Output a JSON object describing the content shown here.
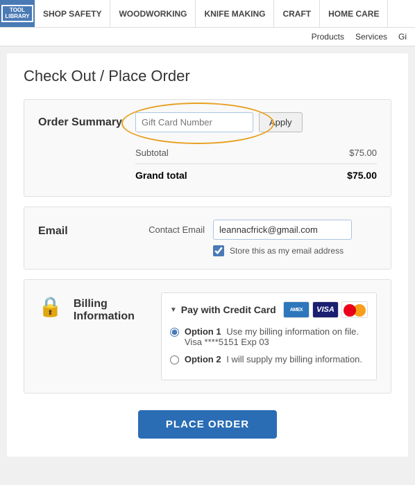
{
  "nav": {
    "logo_line1": "TOOL",
    "logo_line2": "LIBRARY",
    "items": [
      {
        "id": "shop-safety",
        "label": "SHOP SAFETY"
      },
      {
        "id": "woodworking",
        "label": "WOODWORKING"
      },
      {
        "id": "knife-making",
        "label": "KNIFE MAKING"
      },
      {
        "id": "craft",
        "label": "CRAFT"
      },
      {
        "id": "home-care",
        "label": "HOME CARE"
      }
    ]
  },
  "secondary_nav": {
    "items": [
      {
        "id": "products",
        "label": "Products"
      },
      {
        "id": "services",
        "label": "Services"
      },
      {
        "id": "gi",
        "label": "Gi"
      }
    ]
  },
  "page": {
    "title": "Check Out / Place Order"
  },
  "order_summary": {
    "section_label": "Order Summary",
    "gift_card_placeholder": "Gift Card Number",
    "apply_button": "Apply",
    "subtotal_label": "Subtotal",
    "subtotal_value": "$75.00",
    "grand_total_label": "Grand total",
    "grand_total_value": "$75.00"
  },
  "email": {
    "section_label": "Email",
    "contact_label": "Contact Email",
    "email_value": "leannacfrick@gmail.com",
    "store_email_label": "Store this as my email address"
  },
  "billing": {
    "section_label": "Billing Information",
    "pay_label": "Pay with Credit Card",
    "option1_label": "Option 1",
    "option1_text": "Use my billing information on file. Visa ****5151 Exp 03",
    "option2_label": "Option 2",
    "option2_text": "I will supply my billing information."
  },
  "place_order": {
    "button_label": "PLACE ORDER"
  }
}
